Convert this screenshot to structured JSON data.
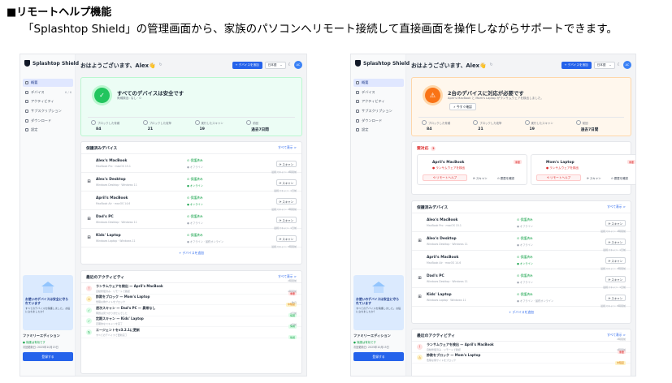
{
  "heading": "■リモートヘルプ機能",
  "subheading": "「Splashtop Shield」の管理画面から、家族のパソコンへリモート接続して直接画面を操作しながらサポートできます。",
  "app": {
    "logo": "Splashtop Shield",
    "nav": [
      {
        "label": "概要",
        "count": ""
      },
      {
        "label": "デバイス",
        "count": "6 / 6"
      },
      {
        "label": "アクティビティ",
        "count": ""
      },
      {
        "label": "サブスクリプション",
        "count": ""
      },
      {
        "label": "ダウンロード",
        "count": ""
      },
      {
        "label": "設定",
        "count": ""
      }
    ],
    "greeting": "おはようございます、Alex",
    "wave": "👋",
    "add_device": "+ デバイスを追加",
    "language": "日本語",
    "language_caret": "⌄",
    "avatar": "AC",
    "promo": {
      "title": "お使いのデバイスは安全に守られています",
      "desc": "すべてのデバイスを保護しました。お役に立ちましたか？"
    },
    "plan": {
      "name": "ファミリーエディション",
      "status": "● 保護は有効です",
      "until": "次回更新日: 2025年10月15日",
      "button": "登録する"
    },
    "stat_labels": [
      "ブロックした脅威",
      "ブロックした攻撃",
      "実行したスキャン",
      "前回"
    ],
    "stat_values": [
      "84",
      "21",
      "19",
      "過去7日間"
    ],
    "protected_title": "保護済みデバイス",
    "see_all": "すべて表示 >",
    "scan": "⟳ スキャン",
    "devices": [
      {
        "name": "Alex's MacBook",
        "os": "MacBook Pro · macOS 15.1",
        "status": "保護済み",
        "online": "● オフライン",
        "online_flag": "off",
        "last": "最終スキャン: 2時間前",
        "icon": ""
      },
      {
        "name": "Alex's Desktop",
        "os": "Windows Desktop · Windows 11",
        "status": "保護済み",
        "online": "● オンライン",
        "online_flag": "on",
        "last": "最終スキャン: 1日前",
        "icon": "⊞"
      },
      {
        "name": "April's MacBook",
        "os": "MacBook Air · macOS 14.6",
        "status": "保護済み",
        "online": "● オンライン",
        "online_flag": "on",
        "last": "最終スキャン: 3時間前",
        "icon": ""
      },
      {
        "name": "Dad's PC",
        "os": "Windows Desktop · Windows 11",
        "status": "保護済み",
        "online": "● オフライン",
        "online_flag": "off",
        "last": "最終スキャン: 1日前",
        "icon": "⊞"
      },
      {
        "name": "Kids' Laptop",
        "os": "Windows Laptop · Windows 11",
        "status": "保護済み",
        "online": "● オフライン · 最終オンライン",
        "online_flag": "off",
        "last": "最終スキャン: 5時間前",
        "icon": "⊞"
      }
    ],
    "add_device_row": "+ デバイスを追加",
    "activity_title": "最近のアクティビティ",
    "activities": [
      {
        "title": "ランサムウェアを検出 — April's MacBook",
        "sub": "自動修復済み · リモートで確認",
        "time": "2時間前",
        "badge": "重要",
        "badge_color": "#dc2626",
        "badge_bg": "#fee2e2",
        "icon_bg": "#fee2e2",
        "icon_fg": "#dc2626",
        "icon": "!"
      },
      {
        "title": "詐欺をブロック — Mom's Laptop",
        "sub": "危険な偽サイトをブロック",
        "time": "4時間前",
        "badge": "中程度",
        "badge_color": "#d97706",
        "badge_bg": "#fef3c7",
        "icon_bg": "#fef3c7",
        "icon_fg": "#d97706",
        "icon": "⚠"
      },
      {
        "title": "週次スキャン — Dad's PC — 異常なし",
        "sub": "問題は見つかりませんでした",
        "time": "昨日",
        "badge": "情報",
        "badge_color": "#16a34a",
        "badge_bg": "#dcfce7",
        "icon_bg": "#dcfce7",
        "icon_fg": "#16a34a",
        "icon": "✓"
      },
      {
        "title": "定期スキャン — Kids' Laptop",
        "sub": "定期的なスキャンを完了",
        "time": "2日前",
        "badge": "情報",
        "badge_color": "#16a34a",
        "badge_bg": "#dcfce7",
        "icon_bg": "#dcfce7",
        "icon_fg": "#16a34a",
        "icon": "✓"
      },
      {
        "title": "エージェントをv3.2.1に更新",
        "sub": "すべてのデバイスで更新完了",
        "time": "3日前",
        "badge": "情報",
        "badge_color": "#16a34a",
        "badge_bg": "#dcfce7",
        "icon_bg": "#dcfce7",
        "icon_fg": "#16a34a",
        "icon": "↻"
      }
    ]
  },
  "left": {
    "status_title": "すべてのデバイスは安全です",
    "status_sub": "脅威検出: なし · 0"
  },
  "right": {
    "status_title": "2台のデバイスに対応が必要です",
    "status_sub": "April's MacBook と Mom's Laptop がランサムウェアを検出しました。",
    "fix_button": "⚡ 今すぐ確認",
    "alert_title": "要対応",
    "alert_count": "2",
    "alerts": [
      {
        "name": "April's MacBook",
        "risk": "● ランサムウェアを検出",
        "tag": "重要"
      },
      {
        "name": "Mom's Laptop",
        "risk": "● ランサムウェアを検出",
        "tag": "重要"
      }
    ],
    "remote_help": "⟲ リモートヘルプ",
    "alert_scan": "⟳ スキャン",
    "alert_history": "⊙ 履歴を確認",
    "devices": [
      {
        "name": "Alex's MacBook",
        "os": "MacBook Pro · macOS 15.1",
        "status": "保護済み",
        "online": "● オフライン",
        "online_flag": "off",
        "last": "最終スキャン: 2時間前",
        "icon": ""
      },
      {
        "name": "Alex's Desktop",
        "os": "Windows Desktop · Windows 11",
        "status": "保護済み",
        "online": "● オフライン",
        "online_flag": "off",
        "last": "最終スキャン: 1日前",
        "icon": "⊞"
      },
      {
        "name": "April's MacBook",
        "os": "MacBook Air · macOS 14.6",
        "status": "保護済み",
        "online": "● オンライン",
        "online_flag": "on",
        "last": "最終スキャン: 3時間前",
        "icon": ""
      },
      {
        "name": "Dad's PC",
        "os": "Windows Desktop · Windows 11",
        "status": "保護済み",
        "online": "● オフライン",
        "online_flag": "off",
        "last": "最終スキャン: 1日前",
        "icon": "⊞"
      },
      {
        "name": "Kids' Laptop",
        "os": "Windows Laptop · Windows 11",
        "status": "保護済み",
        "online": "● オフライン · 最終オンライン",
        "online_flag": "off",
        "last": "最終スキャン: 5時間前",
        "icon": "⊞"
      }
    ]
  }
}
